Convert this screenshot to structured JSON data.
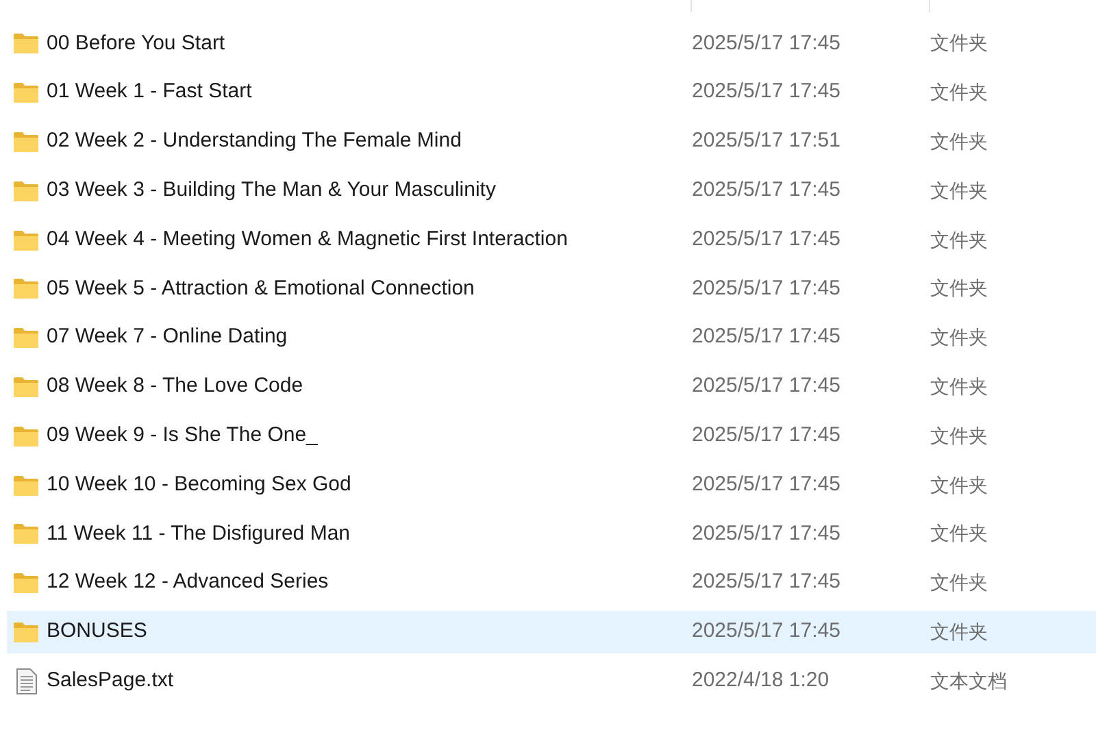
{
  "files": [
    {
      "name": "00 Before You Start",
      "date": "2025/5/17 17:45",
      "type": "文件夹",
      "kind": "folder",
      "selected": false
    },
    {
      "name": "01 Week 1 - Fast Start",
      "date": "2025/5/17 17:45",
      "type": "文件夹",
      "kind": "folder",
      "selected": false
    },
    {
      "name": "02 Week 2 - Understanding The Female Mind",
      "date": "2025/5/17 17:51",
      "type": "文件夹",
      "kind": "folder",
      "selected": false
    },
    {
      "name": "03 Week 3 - Building The Man & Your Masculinity",
      "date": "2025/5/17 17:45",
      "type": "文件夹",
      "kind": "folder",
      "selected": false
    },
    {
      "name": "04 Week 4 - Meeting Women & Magnetic First Interaction",
      "date": "2025/5/17 17:45",
      "type": "文件夹",
      "kind": "folder",
      "selected": false
    },
    {
      "name": "05 Week 5 - Attraction & Emotional Connection",
      "date": "2025/5/17 17:45",
      "type": "文件夹",
      "kind": "folder",
      "selected": false
    },
    {
      "name": "07 Week 7 - Online Dating",
      "date": "2025/5/17 17:45",
      "type": "文件夹",
      "kind": "folder",
      "selected": false
    },
    {
      "name": "08 Week 8 - The Love Code",
      "date": "2025/5/17 17:45",
      "type": "文件夹",
      "kind": "folder",
      "selected": false
    },
    {
      "name": "09 Week 9 - Is She The One_",
      "date": "2025/5/17 17:45",
      "type": "文件夹",
      "kind": "folder",
      "selected": false
    },
    {
      "name": "10 Week 10 - Becoming Sex God",
      "date": "2025/5/17 17:45",
      "type": "文件夹",
      "kind": "folder",
      "selected": false
    },
    {
      "name": "11 Week 11 - The Disfigured Man",
      "date": "2025/5/17 17:45",
      "type": "文件夹",
      "kind": "folder",
      "selected": false
    },
    {
      "name": "12 Week 12 - Advanced Series",
      "date": "2025/5/17 17:45",
      "type": "文件夹",
      "kind": "folder",
      "selected": false
    },
    {
      "name": "BONUSES",
      "date": "2025/5/17 17:45",
      "type": "文件夹",
      "kind": "folder",
      "selected": true
    },
    {
      "name": "SalesPage.txt",
      "date": "2022/4/18 1:20",
      "type": "文本文档",
      "kind": "text",
      "selected": false
    }
  ]
}
